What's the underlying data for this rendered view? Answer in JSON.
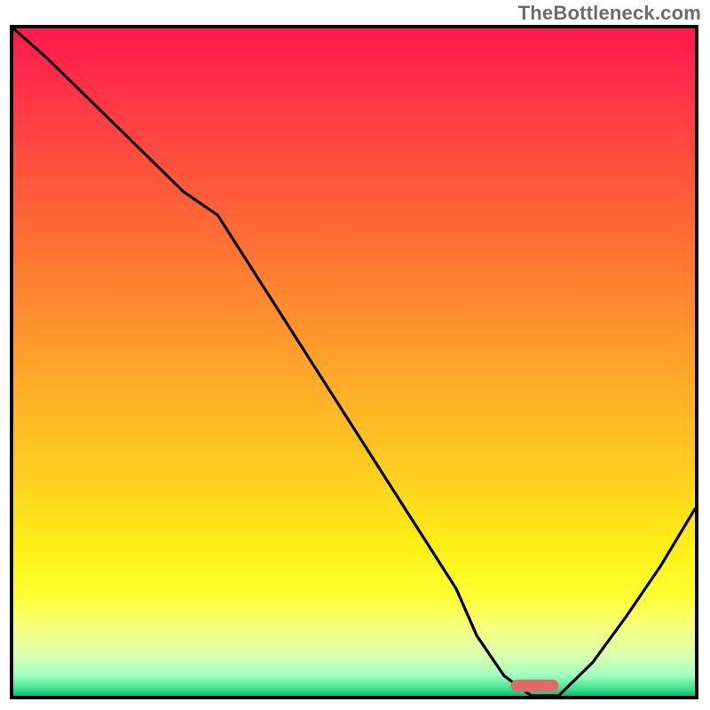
{
  "watermark": "TheBottleneck.com",
  "chart_data": {
    "type": "line",
    "title": "",
    "xlabel": "",
    "ylabel": "",
    "xlim": [
      0,
      1
    ],
    "ylim": [
      0,
      1
    ],
    "x": [
      0.0,
      0.05,
      0.1,
      0.15,
      0.2,
      0.25,
      0.3,
      0.35,
      0.4,
      0.45,
      0.5,
      0.55,
      0.6,
      0.65,
      0.68,
      0.72,
      0.76,
      0.8,
      0.85,
      0.9,
      0.95,
      1.0
    ],
    "y": [
      1.0,
      0.955,
      0.905,
      0.855,
      0.805,
      0.755,
      0.72,
      0.64,
      0.56,
      0.48,
      0.4,
      0.32,
      0.24,
      0.16,
      0.09,
      0.03,
      0.0,
      0.0,
      0.05,
      0.12,
      0.195,
      0.28
    ],
    "marker": {
      "x_start": 0.73,
      "x_end": 0.8,
      "y": 0.015,
      "color": "#e06a6a"
    },
    "background_gradient": {
      "stops": [
        {
          "offset": 0.0,
          "color": "#ff1a4d"
        },
        {
          "offset": 0.08,
          "color": "#ff2e4a"
        },
        {
          "offset": 0.18,
          "color": "#ff4a3f"
        },
        {
          "offset": 0.3,
          "color": "#ff6a36"
        },
        {
          "offset": 0.42,
          "color": "#ff8c2e"
        },
        {
          "offset": 0.55,
          "color": "#ffb028"
        },
        {
          "offset": 0.68,
          "color": "#ffd21f"
        },
        {
          "offset": 0.78,
          "color": "#fff017"
        },
        {
          "offset": 0.85,
          "color": "#ffff33"
        },
        {
          "offset": 0.9,
          "color": "#f6ff80"
        },
        {
          "offset": 0.94,
          "color": "#dcffb0"
        },
        {
          "offset": 0.97,
          "color": "#9cffbf"
        },
        {
          "offset": 0.99,
          "color": "#40e090"
        },
        {
          "offset": 1.0,
          "color": "#00c070"
        }
      ]
    }
  }
}
